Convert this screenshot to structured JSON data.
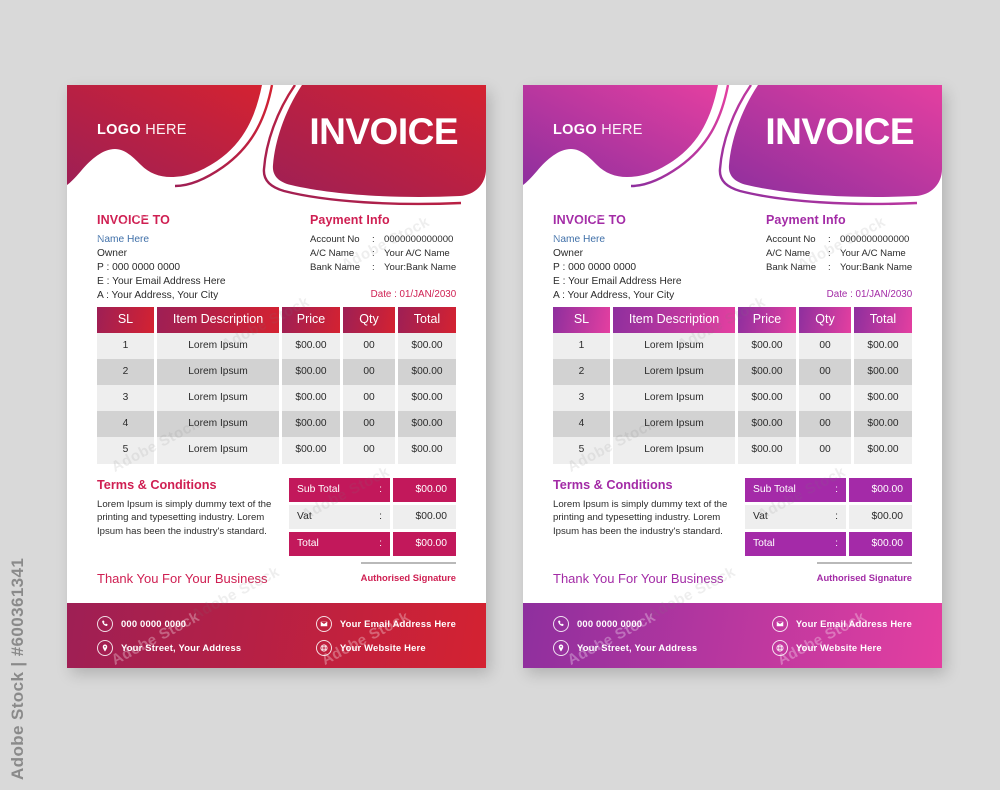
{
  "watermark": {
    "side_text": "Adobe Stock | #600361341",
    "tile_text": "Adobe Stock"
  },
  "palette": {
    "red_grad_start": "#9e1f55",
    "red_grad_end": "#d42231",
    "red_accent": "#c2185b",
    "red_title": "#cf1f52",
    "purple_grad_start": "#8e2f9e",
    "purple_grad_end": "#e43fa0",
    "purple_accent": "#a42aa8",
    "purple_title": "#a32ba6",
    "row_odd": "#eeeeee",
    "row_even": "#d2d2d2",
    "name_blue": "#3f6fa8"
  },
  "invoices": [
    {
      "variant": "red",
      "header": {
        "logo_bold": "LOGO",
        "logo_light": " HERE",
        "title": "INVOICE"
      },
      "invoice_to": {
        "heading": "INVOICE TO",
        "name": "Name Here",
        "role": "Owner",
        "phone": "P : 000 0000 0000",
        "email": "E : Your Email Address Here",
        "address": "A : Your Address, Your City"
      },
      "payment_info": {
        "heading": "Payment Info",
        "rows": [
          {
            "key": "Account No",
            "colon": ":",
            "value": "0000000000000"
          },
          {
            "key": "A/C Name",
            "colon": ":",
            "value": "Your A/C Name"
          },
          {
            "key": "Bank Name",
            "colon": ":",
            "value": "Your:Bank Name"
          }
        ],
        "date": "Date : 01/JAN/2030"
      },
      "table": {
        "columns": [
          "SL",
          "Item Description",
          "Price",
          "Qty",
          "Total"
        ],
        "rows": [
          [
            "1",
            "Lorem Ipsum",
            "$00.00",
            "00",
            "$00.00"
          ],
          [
            "2",
            "Lorem Ipsum",
            "$00.00",
            "00",
            "$00.00"
          ],
          [
            "3",
            "Lorem Ipsum",
            "$00.00",
            "00",
            "$00.00"
          ],
          [
            "4",
            "Lorem Ipsum",
            "$00.00",
            "00",
            "$00.00"
          ],
          [
            "5",
            "Lorem Ipsum",
            "$00.00",
            "00",
            "$00.00"
          ]
        ]
      },
      "terms": {
        "heading": "Terms & Conditions",
        "body": "Lorem Ipsum is simply dummy text of the printing and typesetting industry. Lorem Ipsum has been the industry's standard."
      },
      "totals": [
        {
          "label": "Sub Total",
          "colon": ":",
          "value": "$00.00",
          "filled": true
        },
        {
          "label": "Vat",
          "colon": ":",
          "value": "$00.00",
          "filled": false
        },
        {
          "label": "Total",
          "colon": ":",
          "value": "$00.00",
          "filled": true
        }
      ],
      "thanks": "Thank You For Your Business",
      "signature": "Authorised Signature",
      "footer": {
        "phone": "000 0000 0000",
        "street": "Your Street, Your Address",
        "email": "Your Email Address Here",
        "website": "Your Website Here",
        "icons": [
          "phone-icon",
          "location-pin-icon",
          "envelope-icon",
          "globe-icon"
        ]
      }
    },
    {
      "variant": "purple",
      "header": {
        "logo_bold": "LOGO",
        "logo_light": " HERE",
        "title": "INVOICE"
      },
      "invoice_to": {
        "heading": "INVOICE TO",
        "name": "Name Here",
        "role": "Owner",
        "phone": "P : 000 0000 0000",
        "email": "E : Your Email Address Here",
        "address": "A : Your Address, Your City"
      },
      "payment_info": {
        "heading": "Payment Info",
        "rows": [
          {
            "key": "Account No",
            "colon": ":",
            "value": "0000000000000"
          },
          {
            "key": "A/C Name",
            "colon": ":",
            "value": "Your A/C Name"
          },
          {
            "key": "Bank Name",
            "colon": ":",
            "value": "Your:Bank Name"
          }
        ],
        "date": "Date : 01/JAN/2030"
      },
      "table": {
        "columns": [
          "SL",
          "Item Description",
          "Price",
          "Qty",
          "Total"
        ],
        "rows": [
          [
            "1",
            "Lorem Ipsum",
            "$00.00",
            "00",
            "$00.00"
          ],
          [
            "2",
            "Lorem Ipsum",
            "$00.00",
            "00",
            "$00.00"
          ],
          [
            "3",
            "Lorem Ipsum",
            "$00.00",
            "00",
            "$00.00"
          ],
          [
            "4",
            "Lorem Ipsum",
            "$00.00",
            "00",
            "$00.00"
          ],
          [
            "5",
            "Lorem Ipsum",
            "$00.00",
            "00",
            "$00.00"
          ]
        ]
      },
      "terms": {
        "heading": "Terms & Conditions",
        "body": "Lorem Ipsum is simply dummy text of the printing and typesetting industry. Lorem Ipsum has been the industry's standard."
      },
      "totals": [
        {
          "label": "Sub Total",
          "colon": ":",
          "value": "$00.00",
          "filled": true
        },
        {
          "label": "Vat",
          "colon": ":",
          "value": "$00.00",
          "filled": false
        },
        {
          "label": "Total",
          "colon": ":",
          "value": "$00.00",
          "filled": true
        }
      ],
      "thanks": "Thank You For Your Business",
      "signature": "Authorised Signature",
      "footer": {
        "phone": "000 0000 0000",
        "street": "Your Street, Your Address",
        "email": "Your Email Address Here",
        "website": "Your Website Here",
        "icons": [
          "phone-icon",
          "location-pin-icon",
          "envelope-icon",
          "globe-icon"
        ]
      }
    }
  ]
}
